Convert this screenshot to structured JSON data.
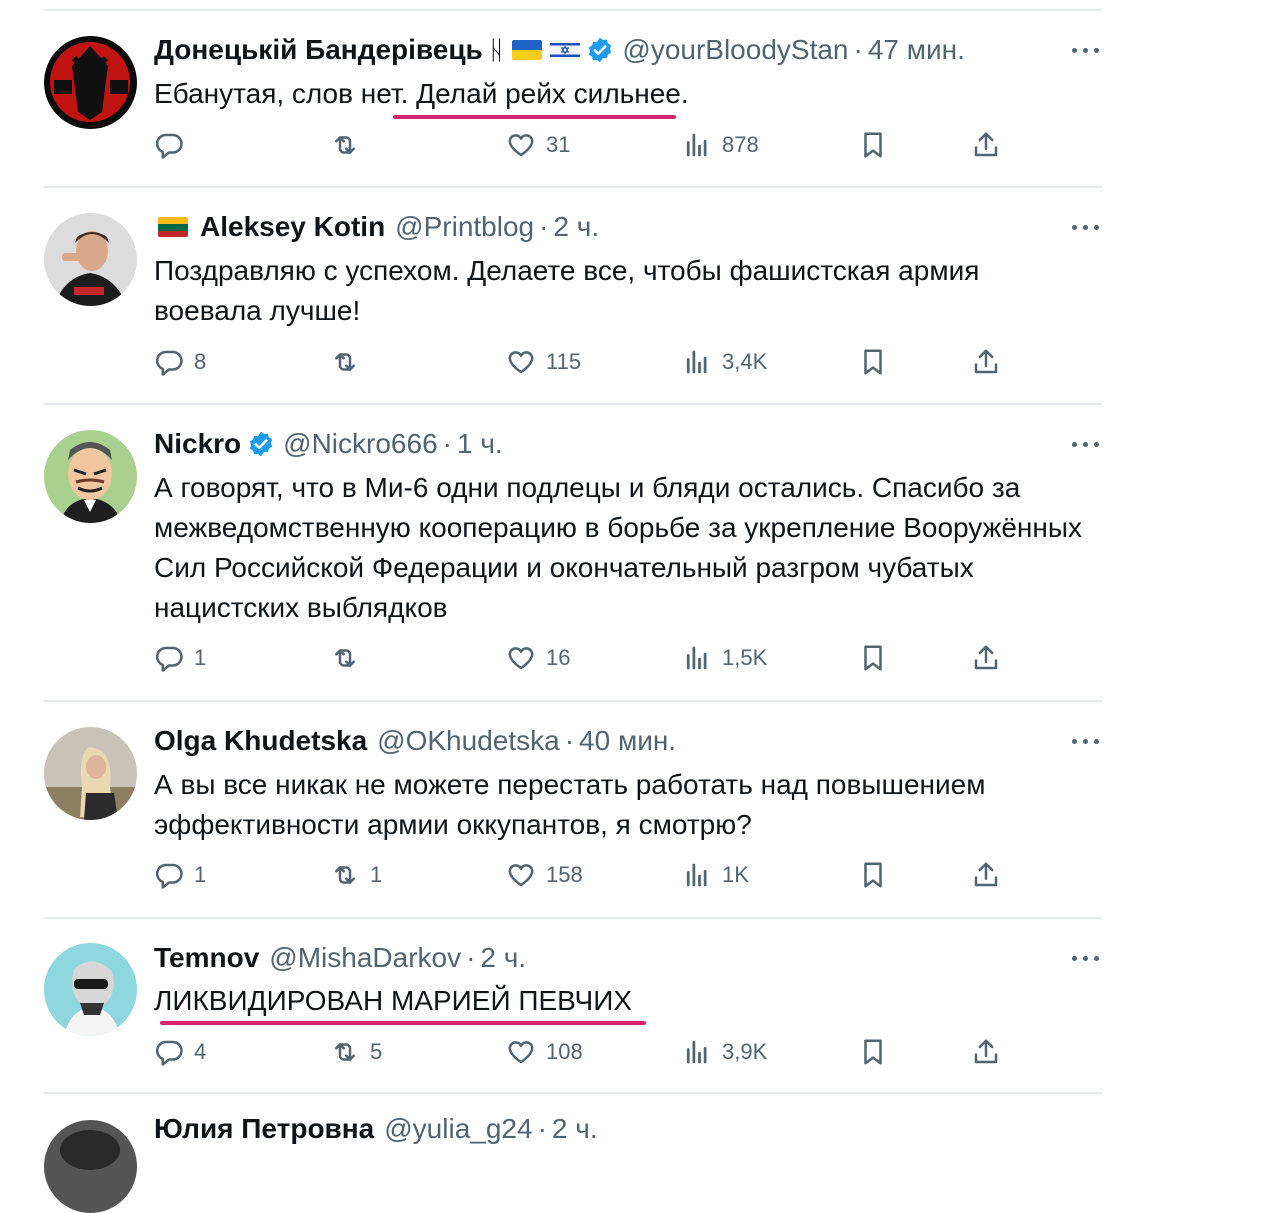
{
  "tweets": [
    {
      "name": "Донецькій Бандерівець",
      "name_extra": "ᚺ",
      "flags": [
        "ukraine-flag",
        "israel-flag"
      ],
      "verified": true,
      "handle": "@yourBloodyStan",
      "time": "47 мин.",
      "text": "Ебанутая, слов нет. Делай рейх сильнее.",
      "replies": "",
      "retweets": "",
      "likes": "31",
      "views": "878"
    },
    {
      "name": "Aleksey Kotin",
      "flag_before_name": "lithuania-flag",
      "verified": false,
      "handle": "@Printblog",
      "time": "2 ч.",
      "text": "Поздравляю с успехом. Делаете все, чтобы фашистская армия воевала лучше!",
      "replies": "8",
      "retweets": "",
      "likes": "115",
      "views": "3,4K"
    },
    {
      "name": "Nickro",
      "verified": true,
      "handle": "@Nickro666",
      "time": "1 ч.",
      "text": "А говорят, что в Ми-6 одни подлецы и бляди остались. Спасибо за межведомственную кооперацию в борьбе за укрепление Вооружённых Сил Российской Федерации и окончательный разгром чубатых нацистских выблядков",
      "replies": "1",
      "retweets": "",
      "likes": "16",
      "views": "1,5K"
    },
    {
      "name": "Olga Khudetska",
      "verified": false,
      "handle": "@OKhudetska",
      "time": "40 мин.",
      "text": "А вы все никак не можете перестать работать над повышением эффективности армии оккупантов, я смотрю?",
      "replies": "1",
      "retweets": "1",
      "likes": "158",
      "views": "1K"
    },
    {
      "name": "Temnov",
      "verified": false,
      "handle": "@MishaDarkov",
      "time": "2 ч.",
      "text": "ЛИКВИДИРОВАН МАРИЕЙ ПЕВЧИХ",
      "replies": "4",
      "retweets": "5",
      "likes": "108",
      "views": "3,9K"
    },
    {
      "name": "Юлия Петровна",
      "handle": "@yulia_g24",
      "time": "2 ч."
    }
  ],
  "icons": {
    "reply": "reply-icon",
    "retweet": "retweet-icon",
    "like": "like-icon",
    "views": "views-icon",
    "bookmark": "bookmark-icon",
    "share": "share-icon",
    "more": "more-icon",
    "verified": "verified-badge-icon"
  },
  "colors": {
    "text": "#0f1419",
    "muted": "#536471",
    "verified": "#1d9bf0",
    "highlight_underline": "#d6246e",
    "divider": "#e6e9ec"
  }
}
